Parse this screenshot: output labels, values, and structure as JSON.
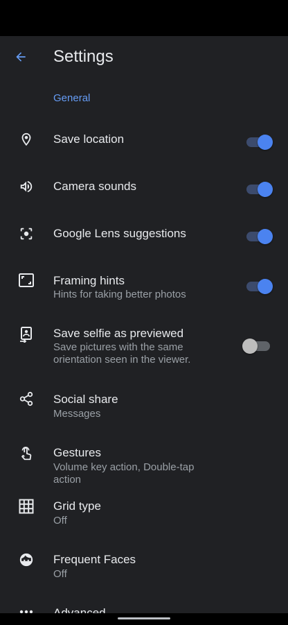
{
  "header": {
    "title": "Settings"
  },
  "section_general": "General",
  "items": [
    {
      "label": "Save location",
      "icon": "location-pin-icon",
      "toggle": true
    },
    {
      "label": "Camera sounds",
      "icon": "speaker-icon",
      "toggle": true
    },
    {
      "label": "Google Lens suggestions",
      "icon": "google-lens-icon",
      "toggle": true
    },
    {
      "label": "Framing hints",
      "sub": "Hints for taking better photos",
      "icon": "frame-icon",
      "toggle": true
    },
    {
      "label": "Save selfie as previewed",
      "sub": "Save pictures with the same orientation seen in the viewer.",
      "icon": "selfie-icon",
      "toggle": false
    },
    {
      "label": "Social share",
      "sub": "Messages",
      "icon": "share-icon"
    },
    {
      "label": "Gestures",
      "sub": "Volume key action, Double-tap action",
      "icon": "gesture-icon"
    },
    {
      "label": "Grid type",
      "sub": "Off",
      "icon": "grid-icon"
    },
    {
      "label": "Frequent Faces",
      "sub": "Off",
      "icon": "face-icon"
    },
    {
      "label": "Advanced",
      "icon": "more-icon"
    }
  ],
  "colors": {
    "accent": "#669df6",
    "background": "#202124"
  }
}
